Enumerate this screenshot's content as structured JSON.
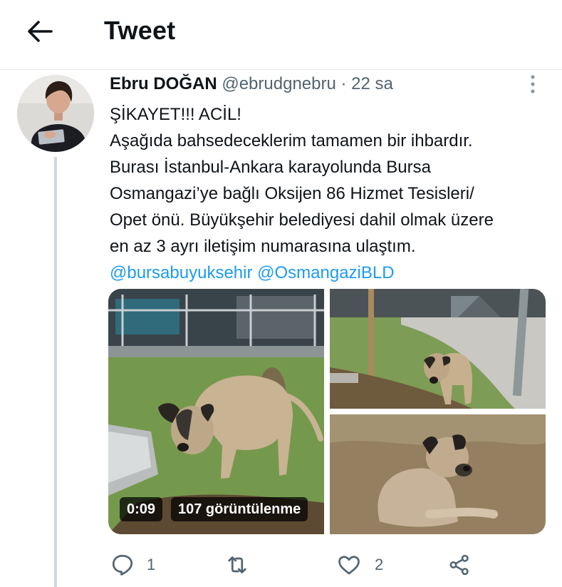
{
  "header": {
    "title": "Tweet",
    "back_icon": "arrow-left-icon"
  },
  "tweet": {
    "author_name": "Ebru DOĞAN",
    "author_handle": "@ebrudgnebru",
    "separator": "·",
    "time": "22 sa",
    "text_lines": [
      "ŞİKAYET!!! ACİL!",
      "Aşağıda bahsedeceklerim tamamen bir ihbardır.",
      "Burası İstanbul-Ankara karayolunda Bursa",
      "Osmangazi’ye bağlı Oksijen 86 Hizmet Tesisleri/",
      "Opet önü. Büyükşehir belediyesi dahil olmak üzere",
      "en az 3 ayrı iletişim numarasına ulaştım."
    ],
    "mentions": [
      "@bursabuyuksehir",
      "@OsmangaziBLD"
    ],
    "video": {
      "duration": "0:09",
      "views": "107 görüntülenme"
    }
  },
  "actions": {
    "reply_count": "1",
    "like_count": "2",
    "icons": [
      "reply-icon",
      "retweet-icon",
      "like-icon",
      "share-icon"
    ]
  },
  "colors": {
    "link": "#1d9bf0",
    "secondary_text": "#536471",
    "divider": "#e6e9ec"
  }
}
